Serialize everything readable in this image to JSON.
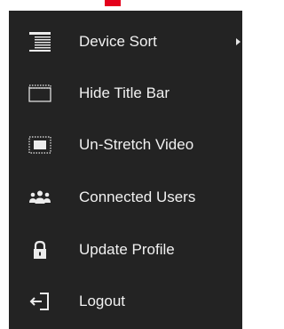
{
  "colors": {
    "menu_background": "#232323",
    "text": "#f1f1f1",
    "pointer": "#e4001b"
  },
  "menu": {
    "items": [
      {
        "label": "Device Sort",
        "icon": "list-sort-icon",
        "has_submenu": true
      },
      {
        "label": "Hide Title Bar",
        "icon": "window-titlebar-icon",
        "has_submenu": false
      },
      {
        "label": "Un-Stretch Video",
        "icon": "unstretch-video-icon",
        "has_submenu": false
      },
      {
        "label": "Connected Users",
        "icon": "users-icon",
        "has_submenu": false
      },
      {
        "label": "Update Profile",
        "icon": "lock-icon",
        "has_submenu": false
      },
      {
        "label": "Logout",
        "icon": "logout-icon",
        "has_submenu": false
      }
    ]
  }
}
